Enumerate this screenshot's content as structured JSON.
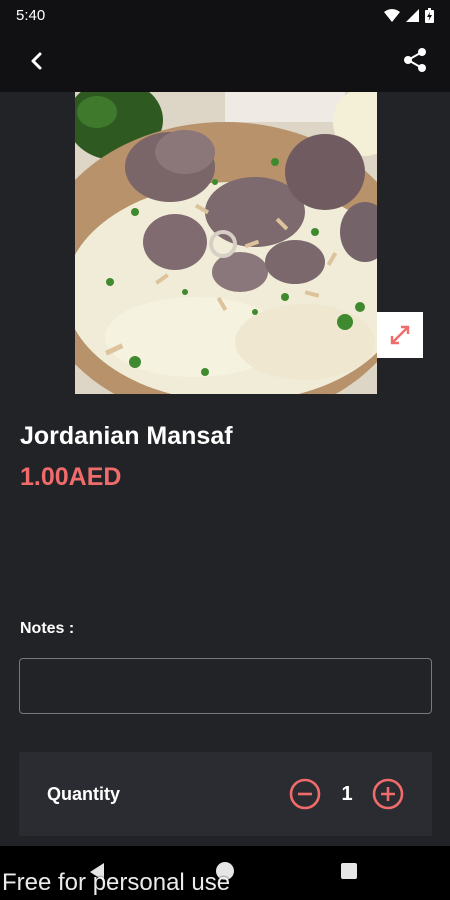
{
  "status_bar": {
    "time": "5:40"
  },
  "product": {
    "name": "Jordanian Mansaf",
    "price": "1.00AED"
  },
  "notes": {
    "label": "Notes :",
    "value": "",
    "placeholder": ""
  },
  "quantity": {
    "label": "Quantity",
    "value": "1"
  },
  "icons": {
    "back": "back-arrow-icon",
    "share": "share-icon",
    "expand": "expand-icon",
    "minus": "minus-circle-icon",
    "plus": "plus-circle-icon"
  },
  "colors": {
    "accent": "#f06b6b",
    "background": "#222327",
    "bar": "#111113"
  },
  "watermark": "Free for personal use"
}
